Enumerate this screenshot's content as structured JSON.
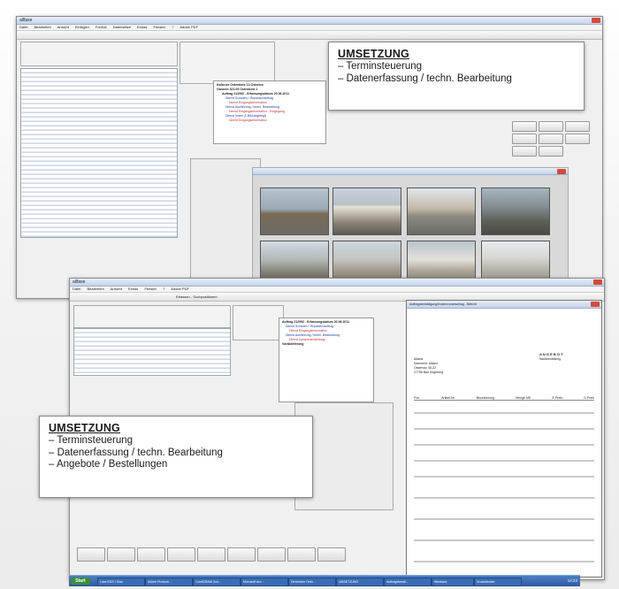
{
  "callout_top": {
    "heading": "UMSETZUNG",
    "items": [
      "– Terminsteuerung",
      "– Datenerfassung / techn. Bearbeitung"
    ]
  },
  "callout_bottom": {
    "heading": "UMSETZUNG",
    "items": [
      "– Terminsteuerung",
      "– Datenerfassung / techn. Bearbeitung",
      "– Angebote / Bestellungen"
    ]
  },
  "screen_top": {
    "window_title": "allfaxe",
    "menu": [
      "Datei",
      "Bearbeiten",
      "Ansicht",
      "Einfügen",
      "Format",
      "Datensätze",
      "Extras",
      "Fenster",
      "?",
      "Adobe PDF"
    ],
    "tree_lines": [
      {
        "text": "Kallenzo  Ostenbote  13 Ostenbo",
        "cls": "k"
      },
      {
        "text": "Ganzeln  321.05 Ostenbote 1",
        "cls": "k"
      },
      {
        "text": "Auftrag  212992 - Erfassungsdatum 20.06.2011",
        "cls": "k"
      },
      {
        "text": "Dienst  Schaden / Reparaturauftrag",
        "cls": "b"
      },
      {
        "text": "Dienst Eingangsinformation",
        "cls": "r"
      },
      {
        "text": "Dienst Ausführung / techn. Bearbeitung",
        "cls": "b"
      },
      {
        "text": "Dienst Eingangsinformation - Eingegang",
        "cls": "r"
      },
      {
        "text": "Dienst Innen (1 Bild abgelegt)",
        "cls": "b"
      },
      {
        "text": "Dienst Eingangsinformation",
        "cls": "r"
      }
    ]
  },
  "screen_bottom": {
    "window_title": "allfaxe",
    "menu": [
      "Datei",
      "Bearbeiten",
      "Ansicht",
      "Extras",
      "Fenster",
      "?",
      "Adobe PDF"
    ],
    "search_label": "Erfassen - Suchpositionen",
    "tree_lines": [
      {
        "text": "Auftrag 212992 - Erfassungsdatum 20.06.2011",
        "cls": "k"
      },
      {
        "text": "Dienst Schaden / Reparaturauftrag",
        "cls": "b"
      },
      {
        "text": "Dienst Eingangsinformation",
        "cls": "r"
      },
      {
        "text": "Dienst Ausführung / techn. Bearbeitung",
        "cls": "b"
      },
      {
        "text": "Dienst Zusammenstellung",
        "cls": "r"
      },
      {
        "text": "Vorablieferung",
        "cls": "k"
      }
    ],
    "doc_title": "Auftragsbestätigung/Kostenvoranschlag - Bericht",
    "doc_heading": "A N G E B O T",
    "doc_subheading": "Nachbestellung",
    "doc_address": [
      "Allianz",
      "Sammelrt. Allianz",
      "Osterholz  36-22",
      "27755 Bad Segeberg"
    ],
    "doc_table_headers": [
      "Pos.",
      "Artikel-Nr.",
      "Bezeichnung",
      "Menge-ME",
      "E-Preis",
      "G-Preis"
    ]
  },
  "taskbar": {
    "start_label": "Start",
    "tasks": [
      "Lose EDS / Glas",
      "Adobe Photosh...",
      "CorelDRAW Gra...",
      "Microsoft Acc...",
      "Dezember Ordn...",
      "UMSETZUNG",
      "Auftragsbestä...",
      "Windows",
      "Druckdienste"
    ],
    "clock": "14:23"
  }
}
